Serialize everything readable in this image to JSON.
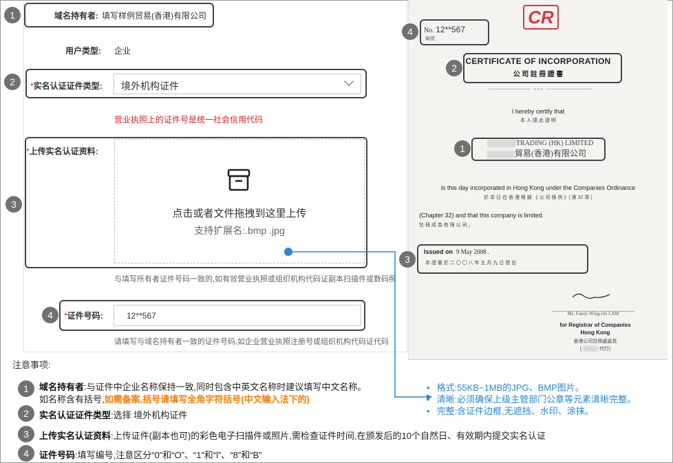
{
  "form": {
    "holder_label": "域名持有者:",
    "holder_value": "填写样例贸易(香港)有限公司",
    "user_type_label": "用户类型:",
    "user_type_value": "企业",
    "cert_type_req": "*",
    "cert_type_label": "实名认证证件类型:",
    "cert_type_value": "境外机构证件",
    "cert_type_tip": "营业执照上的证件号是统一社会信用代码",
    "upload_req": "*",
    "upload_label": "上传实名认证资料:",
    "upload_main": "点击或者文件拖拽到这里上传",
    "upload_sub": "支持扩展名:.bmp .jpg",
    "upload_tip": "与填写所有者证件号码一致的,如有效营业执照或组织机构代码证副本扫描件或数码照",
    "cert_no_req": "*",
    "cert_no_label": "证件号码:",
    "cert_no_value": "12**567",
    "cert_no_tip": "请填写与域名持有者一致的证件号码,如企业营业执照注册号或组织机构代码证代码"
  },
  "badges": [
    "1",
    "2",
    "3",
    "4"
  ],
  "certificate": {
    "logo": "CR",
    "no_label": "No.",
    "no_value": "12**567",
    "no_cn": "編號",
    "title_en": "CERTIFICATE OF INCORPORATION",
    "title_cn": "公 司 註 冊 證 書",
    "stars": "* * *",
    "certify_en": "I hereby certify that",
    "certify_cn": "本 人 謹 此 證 明",
    "company_en": "TRADING (HK) LIMITED",
    "company_cn": "貿易(香港)有限公司",
    "incorporated_en": "is this day incorporated in Hong Kong under the Companies Ordinance",
    "incorporated_cn": "於 本 日 在 香 港 根 據 《 公 司 條 例 》( 第 32 章 )",
    "chapter_en": "(Chapter 32) and that this company is limited.",
    "chapter_cn": "註 冊 成 為 有 限 公 司 。",
    "issued_label": "Issued on",
    "issued_date": "9 May 2008 .",
    "issued_cn": "本 證 書 於 二 〇 〇 八 年 五 月 九 日 發 出",
    "signer": "Ms. Fanny Wing-chi LAM",
    "registrar_en1": "for Registrar of Companies",
    "registrar_en2": "Hong Kong",
    "registrar_cn": "香港公司註冊處處長",
    "registrar_cn2": "代行"
  },
  "notes": {
    "title": "注意事项:",
    "n1_bold": "域名持有者",
    "n1_text": ":与证件中企业名称保持一致,同时包含中英文名称时建议填写中文名称。",
    "n1_line2_a": "如名称含有括号,",
    "n1_line2_b": "如需备案,括号请填写全角字符括号(中文输入法下的)",
    "n2_bold": "实名认证证件类型",
    "n2_text": ":选择 境外机构证件",
    "n3_bold": "上传实名认证资料",
    "n3_text": ":上传证件(副本也可)的彩色电子扫描件或照片,需检查证件时间,在颁发后的10个自然日、有效期内提交实名认证",
    "n4_bold": "证件号码",
    "n4_text": ":填写编号,注意区分“0”和“O”、“1”和“l”、“8”和“B”"
  },
  "requirements": [
    "格式:55KB~1MB的JPG、BMP图片。",
    "清晰:必须确保上级主管部门公章等元素清晰完整。",
    "完整:含证件边框,无遮挡、水印、涂抹。"
  ],
  "colors": {
    "accent_blue": "#2a86d6",
    "required_red": "#e02020",
    "warning_orange": "#ff7a00",
    "badge_gray": "#707070",
    "logo_red": "#e0353b"
  }
}
